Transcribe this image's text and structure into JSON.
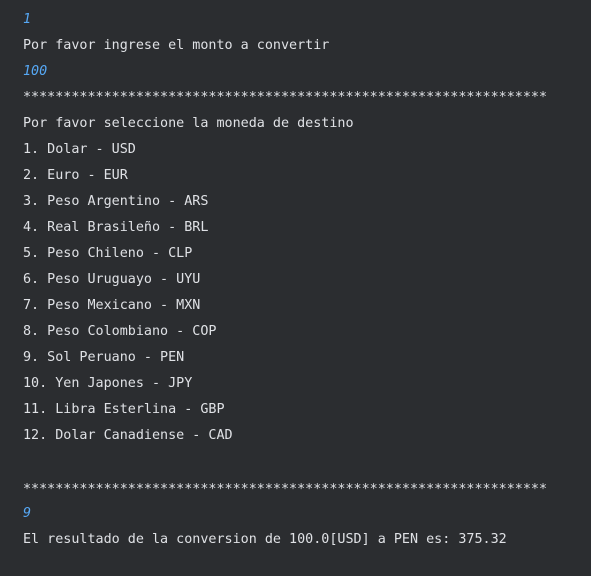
{
  "console": {
    "colors": {
      "background": "#2b2d30",
      "output_text": "#dfe1e5",
      "user_input": "#56a8f5"
    },
    "lines": [
      {
        "kind": "input",
        "text": "1"
      },
      {
        "kind": "output",
        "text": "Por favor ingrese el monto a convertir"
      },
      {
        "kind": "input",
        "text": "100"
      },
      {
        "kind": "separator",
        "text": "*****************************************************************"
      },
      {
        "kind": "output",
        "text": "Por favor seleccione la moneda de destino"
      },
      {
        "kind": "output",
        "text": "1. Dolar - USD"
      },
      {
        "kind": "output",
        "text": "2. Euro - EUR"
      },
      {
        "kind": "output",
        "text": "3. Peso Argentino - ARS"
      },
      {
        "kind": "output",
        "text": "4. Real Brasileño - BRL"
      },
      {
        "kind": "output",
        "text": "5. Peso Chileno - CLP"
      },
      {
        "kind": "output",
        "text": "6. Peso Uruguayo - UYU"
      },
      {
        "kind": "output",
        "text": "7. Peso Mexicano - MXN"
      },
      {
        "kind": "output",
        "text": "8. Peso Colombiano - COP"
      },
      {
        "kind": "output",
        "text": "9. Sol Peruano - PEN"
      },
      {
        "kind": "output",
        "text": "10. Yen Japones - JPY"
      },
      {
        "kind": "output",
        "text": "11. Libra Esterlina - GBP"
      },
      {
        "kind": "output",
        "text": "12. Dolar Canadiense - CAD"
      },
      {
        "kind": "blank",
        "text": ""
      },
      {
        "kind": "separator",
        "text": "*****************************************************************"
      },
      {
        "kind": "input",
        "text": "9"
      },
      {
        "kind": "output",
        "text": "El resultado de la conversion de 100.0[USD] a PEN es: 375.32"
      }
    ]
  }
}
